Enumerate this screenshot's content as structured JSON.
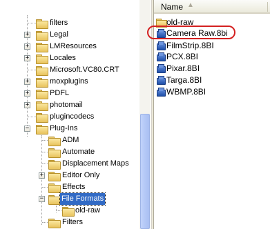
{
  "tree": {
    "items": [
      {
        "label": "filters",
        "expander": ""
      },
      {
        "label": "Legal",
        "expander": "+"
      },
      {
        "label": "LMResources",
        "expander": "+"
      },
      {
        "label": "Locales",
        "expander": "+"
      },
      {
        "label": "Microsoft.VC80.CRT",
        "expander": ""
      },
      {
        "label": "moxplugins",
        "expander": "+"
      },
      {
        "label": "PDFL",
        "expander": "+"
      },
      {
        "label": "photomail",
        "expander": "+"
      },
      {
        "label": "plugincodecs",
        "expander": ""
      },
      {
        "label": "Plug-Ins",
        "expander": "−"
      },
      {
        "label": "ADM",
        "expander": ""
      },
      {
        "label": "Automate",
        "expander": ""
      },
      {
        "label": "Displacement Maps",
        "expander": ""
      },
      {
        "label": "Editor Only",
        "expander": "+"
      },
      {
        "label": "Effects",
        "expander": ""
      },
      {
        "label": "File Formats",
        "expander": "−"
      },
      {
        "label": "old-raw",
        "expander": ""
      },
      {
        "label": "Filters",
        "expander": ""
      }
    ],
    "close_glyph": "×"
  },
  "list": {
    "column_name": "Name",
    "sort_glyph": "▲",
    "files": [
      {
        "name": "old-raw",
        "type": "folder"
      },
      {
        "name": "Camera Raw.8bi",
        "type": "plugin"
      },
      {
        "name": "FilmStrip.8BI",
        "type": "plugin"
      },
      {
        "name": "PCX.8BI",
        "type": "plugin"
      },
      {
        "name": "Pixar.8BI",
        "type": "plugin"
      },
      {
        "name": "Targa.8BI",
        "type": "plugin"
      },
      {
        "name": "WBMP.8BI",
        "type": "plugin"
      }
    ]
  },
  "colors": {
    "selection": "#316ac5",
    "highlight_ring": "#d42020",
    "scroll_thumb": "#b4c8f6"
  }
}
